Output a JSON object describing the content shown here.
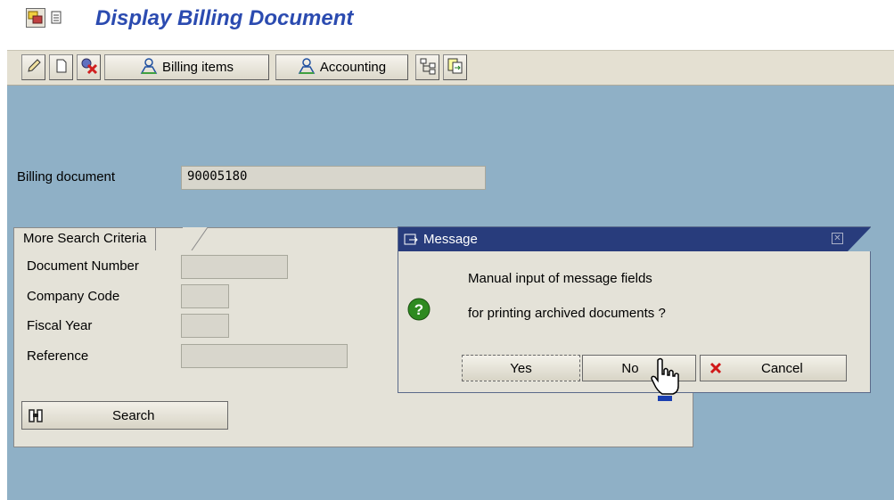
{
  "window": {
    "title": "Display Billing Document"
  },
  "toolbar": {
    "billing_items_label": "Billing items",
    "accounting_label": "Accounting"
  },
  "header": {
    "billing_document_label": "Billing document",
    "billing_document_value": "90005180"
  },
  "search_panel": {
    "tab_label": "More Search Criteria",
    "fields": [
      {
        "label": "Document Number",
        "value": ""
      },
      {
        "label": "Company Code",
        "value": ""
      },
      {
        "label": "Fiscal Year",
        "value": ""
      },
      {
        "label": "Reference",
        "value": ""
      }
    ],
    "search_button_label": "Search"
  },
  "dialog": {
    "title": "Message",
    "message_line1": "Manual input of message fields",
    "message_line2": "for printing archived documents ?",
    "yes_label": "Yes",
    "no_label": "No",
    "cancel_label": "Cancel"
  },
  "colors": {
    "main_background": "#8fb0c6",
    "title_text": "#2b4bb0",
    "dialog_titlebar": "#283c7c"
  }
}
